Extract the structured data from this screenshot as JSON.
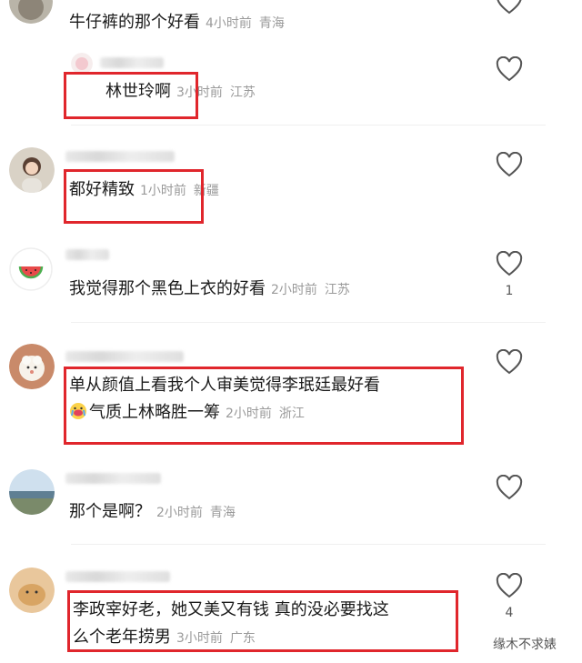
{
  "comments": [
    {
      "id": "c0",
      "text": "牛仔裤的那个好看",
      "time": "4小时前",
      "location": "青海"
    },
    {
      "id": "c1",
      "text": "林世玲啊",
      "time": "3小时前",
      "location": "江苏"
    },
    {
      "id": "c2",
      "text": "都好精致",
      "time": "1小时前",
      "location": "新疆"
    },
    {
      "id": "c3",
      "text": "我觉得那个黑色上衣的好看",
      "time": "2小时前",
      "location": "江苏",
      "likes": "1"
    },
    {
      "id": "c4",
      "text_line1": "单从颜值上看我个人审美觉得李珉廷最好看",
      "text_line2": "气质上林略胜一筹",
      "time": "2小时前",
      "location": "浙江"
    },
    {
      "id": "c5",
      "text": "那个是啊？",
      "time": "2小时前",
      "location": "青海"
    },
    {
      "id": "c6",
      "text_line1": "李政宰好老，她又美又有钱 真的没必要找这",
      "text_line2": "么个老年捞男",
      "time": "3小时前",
      "location": "广东",
      "likes": "4"
    }
  ],
  "watermark": "缘木不求婊",
  "colors": {
    "highlight_box": "#e0262c",
    "meta_text": "#9a9a9a",
    "heart_outline": "#555555"
  }
}
